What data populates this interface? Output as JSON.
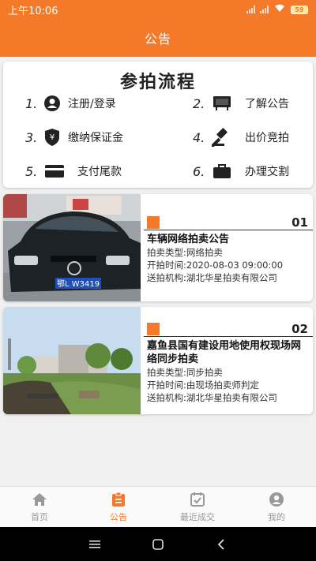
{
  "status_bar": {
    "time": "上午10:06",
    "battery": "59"
  },
  "header": {
    "title": "公告"
  },
  "process": {
    "title": "参拍流程",
    "steps": [
      {
        "num": "1.",
        "label": "注册/登录",
        "icon": "user-icon"
      },
      {
        "num": "2.",
        "label": "了解公告",
        "icon": "notice-board-icon"
      },
      {
        "num": "3.",
        "label": "缴纳保证金",
        "icon": "shield-yen-icon"
      },
      {
        "num": "4.",
        "label": "出价竞拍",
        "icon": "gavel-icon"
      },
      {
        "num": "5.",
        "label": "支付尾款",
        "icon": "card-icon"
      },
      {
        "num": "6.",
        "label": "办理交割",
        "icon": "briefcase-icon"
      }
    ]
  },
  "notices": [
    {
      "no": "01",
      "title": "车辆网络拍卖公告",
      "type": "拍卖类型:网络拍卖",
      "start": "开拍时间:2020-08-03 09:00:00",
      "org": "送拍机构:湖北华星拍卖有限公司",
      "image": "black-sedan-photo",
      "plate": "鄂L W3419"
    },
    {
      "no": "02",
      "title": "嘉鱼县国有建设用地使用权现场网络同步拍卖",
      "type": "拍卖类型:同步拍卖",
      "start": "开拍时间:由现场拍卖师判定",
      "org": "送拍机构:湖北华星拍卖有限公司",
      "image": "land-site-photo"
    }
  ],
  "tabbar": {
    "items": [
      {
        "label": "首页",
        "icon": "home-icon",
        "active": false
      },
      {
        "label": "公告",
        "icon": "clipboard-icon",
        "active": true
      },
      {
        "label": "最近成交",
        "icon": "calendar-check-icon",
        "active": false
      },
      {
        "label": "我的",
        "icon": "profile-icon",
        "active": false
      }
    ]
  },
  "colors": {
    "accent": "#f47a2a",
    "inactive": "#999999"
  }
}
